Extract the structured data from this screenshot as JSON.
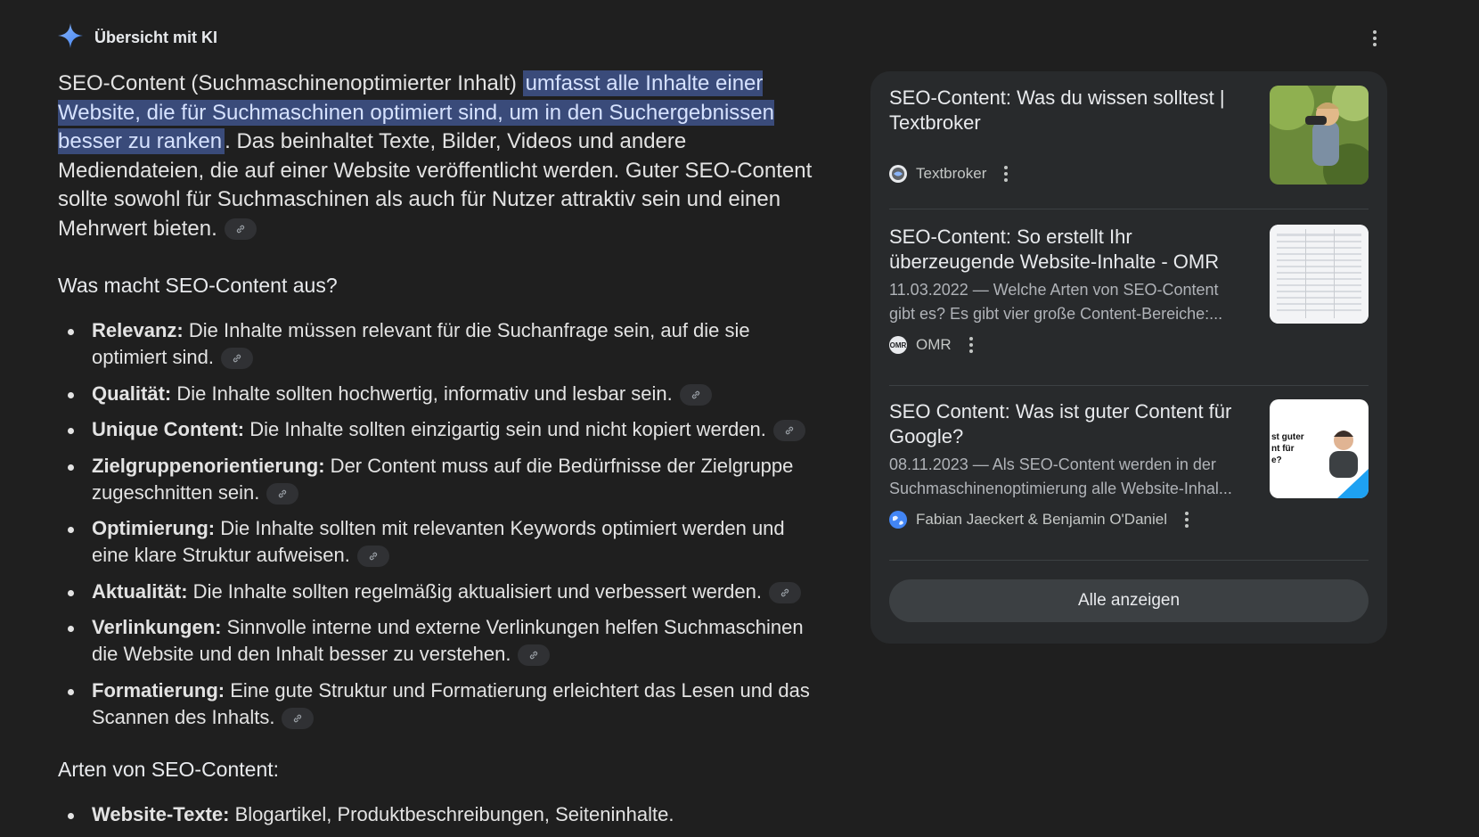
{
  "header": {
    "title": "Übersicht mit KI",
    "icon": "sparkle-icon",
    "menu_icon": "more-vert-icon"
  },
  "intro": {
    "pre": "SEO-Content (Suchmaschinenoptimierter Inhalt) ",
    "highlight": "umfasst alle Inhalte einer Website, die für Suchmaschinen optimiert sind, um in den Suchergebnissen besser zu ranken",
    "post": ". Das beinhaltet Texte, Bilder, Videos und andere Mediendateien, die auf einer Website veröffentlicht werden. Guter SEO-Content sollte sowohl für Suchmaschinen als auch für Nutzer attraktiv sein und einen Mehrwert bieten."
  },
  "section1": {
    "heading": "Was macht SEO-Content aus?",
    "items": [
      {
        "term": "Relevanz:",
        "text": " Die Inhalte müssen relevant für die Suchanfrage sein, auf die sie optimiert sind."
      },
      {
        "term": "Qualität:",
        "text": " Die Inhalte sollten hochwertig, informativ und lesbar sein."
      },
      {
        "term": "Unique Content:",
        "text": " Die Inhalte sollten einzigartig sein und nicht kopiert werden."
      },
      {
        "term": "Zielgruppenorientierung:",
        "text": " Der Content muss auf die Bedürfnisse der Zielgruppe zugeschnitten sein."
      },
      {
        "term": "Optimierung:",
        "text": " Die Inhalte sollten mit relevanten Keywords optimiert werden und eine klare Struktur aufweisen."
      },
      {
        "term": "Aktualität:",
        "text": " Die Inhalte sollten regelmäßig aktualisiert und verbessert werden."
      },
      {
        "term": "Verlinkungen:",
        "text": " Sinnvolle interne und externe Verlinkungen helfen Suchmaschinen die Website und den Inhalt besser zu verstehen."
      },
      {
        "term": "Formatierung:",
        "text": " Eine gute Struktur und Formatierung erleichtert das Lesen und das Scannen des Inhalts."
      }
    ]
  },
  "section2": {
    "heading": "Arten von SEO-Content:",
    "items": [
      {
        "term": "Website-Texte:",
        "text": " Blogartikel, Produktbeschreibungen, Seiteninhalte."
      }
    ]
  },
  "sources": {
    "cards": [
      {
        "title": "SEO-Content: Was du wissen solltest | Textbroker",
        "snippet1": "",
        "snippet2": "",
        "source": "Textbroker"
      },
      {
        "title": "SEO-Content: So erstellt Ihr überzeugende Website-Inhalte - OMR",
        "snippet1": "11.03.2022 — Welche Arten von SEO-Content",
        "snippet2": "gibt es? Es gibt vier große Content-Bereiche:...",
        "source": "OMR"
      },
      {
        "title": "SEO Content: Was ist guter Content für Google?",
        "snippet1": "08.11.2023 — Als SEO-Content werden in der",
        "snippet2": "Suchmaschinenoptimierung alle Website-Inhal...",
        "source": "Fabian Jaeckert & Benjamin O'Daniel"
      }
    ],
    "thumb3_text": [
      "st guter",
      "nt für",
      "e?"
    ],
    "favicon2": "OMR",
    "show_all": "Alle anzeigen"
  },
  "colors": {
    "background": "#1f1f1f",
    "panel": "#282a2c",
    "highlight": "#3a4b7a",
    "accent": "#4285f4"
  }
}
